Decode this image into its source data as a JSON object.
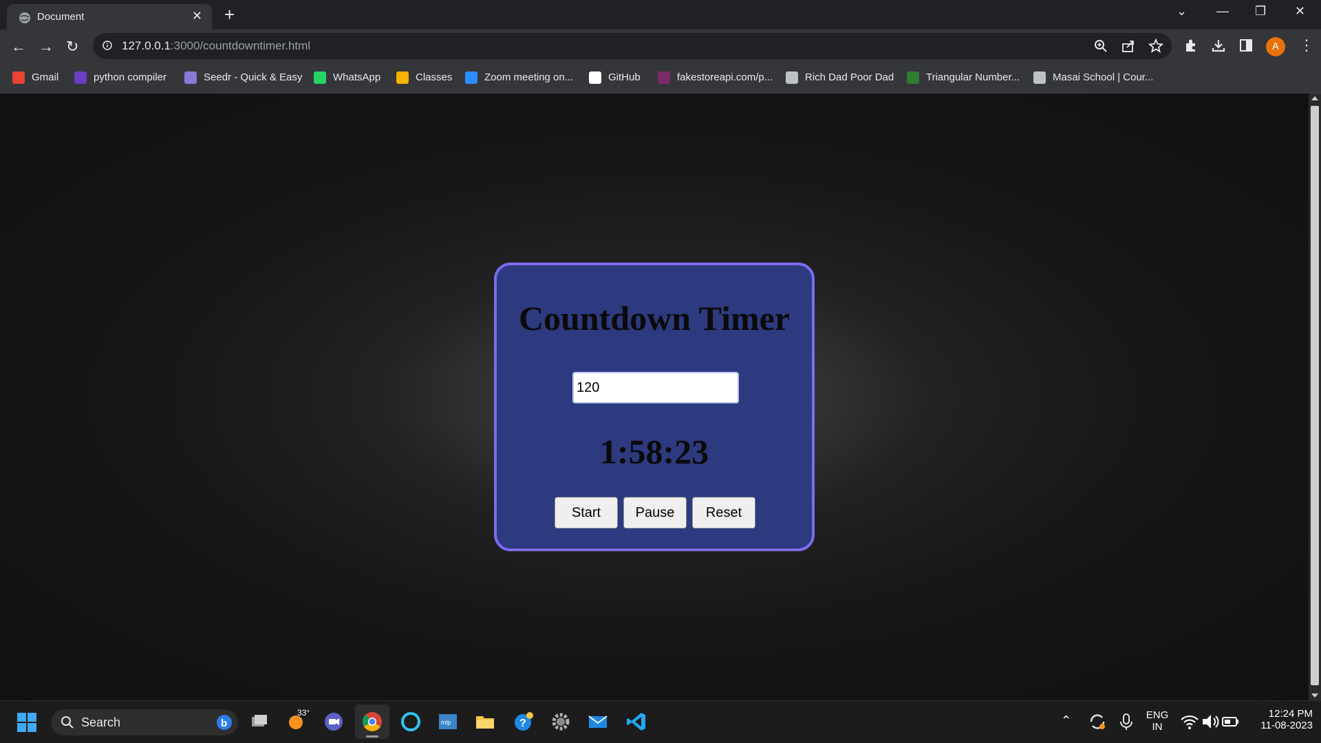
{
  "browser": {
    "tab_title": "Document",
    "url_host": "127.0.0.1",
    "url_path": ":3000/countdowntimer.html",
    "avatar_letter": "A"
  },
  "bookmarks": [
    {
      "label": "Gmail",
      "icon": "gmail-icon",
      "color": "#ea4335"
    },
    {
      "label": "python compiler",
      "icon": "bolt-icon",
      "color": "#6a3fc1"
    },
    {
      "label": "Seedr - Quick & Easy",
      "icon": "seedr-icon",
      "color": "#8b79d9"
    },
    {
      "label": "WhatsApp",
      "icon": "whatsapp-icon",
      "color": "#25d366"
    },
    {
      "label": "Classes",
      "icon": "classroom-icon",
      "color": "#f4b400"
    },
    {
      "label": "Zoom meeting on...",
      "icon": "zoom-icon",
      "color": "#2d8cff"
    },
    {
      "label": "GitHub",
      "icon": "github-icon",
      "color": "#ffffff"
    },
    {
      "label": "fakestoreapi.com/p...",
      "icon": "fakestore-icon",
      "color": "#7a2d6b"
    },
    {
      "label": "Rich Dad Poor Dad",
      "icon": "globe-icon",
      "color": "#bdc1c6"
    },
    {
      "label": "Triangular Number...",
      "icon": "triangular-icon",
      "color": "#2e7d32"
    },
    {
      "label": "Masai School | Cour...",
      "icon": "globe-icon",
      "color": "#bdc1c6"
    }
  ],
  "app": {
    "title": "Countdown Timer",
    "input_value": "120",
    "time_display": "1:58:23",
    "start_label": "Start",
    "pause_label": "Pause",
    "reset_label": "Reset",
    "card_color": "#2d3a7f",
    "border_color": "#7b6cf0"
  },
  "taskbar": {
    "search_label": "Search",
    "weather_temp": "33°",
    "language_line1": "ENG",
    "language_line2": "IN",
    "time": "12:24 PM",
    "date": "11-08-2023"
  }
}
